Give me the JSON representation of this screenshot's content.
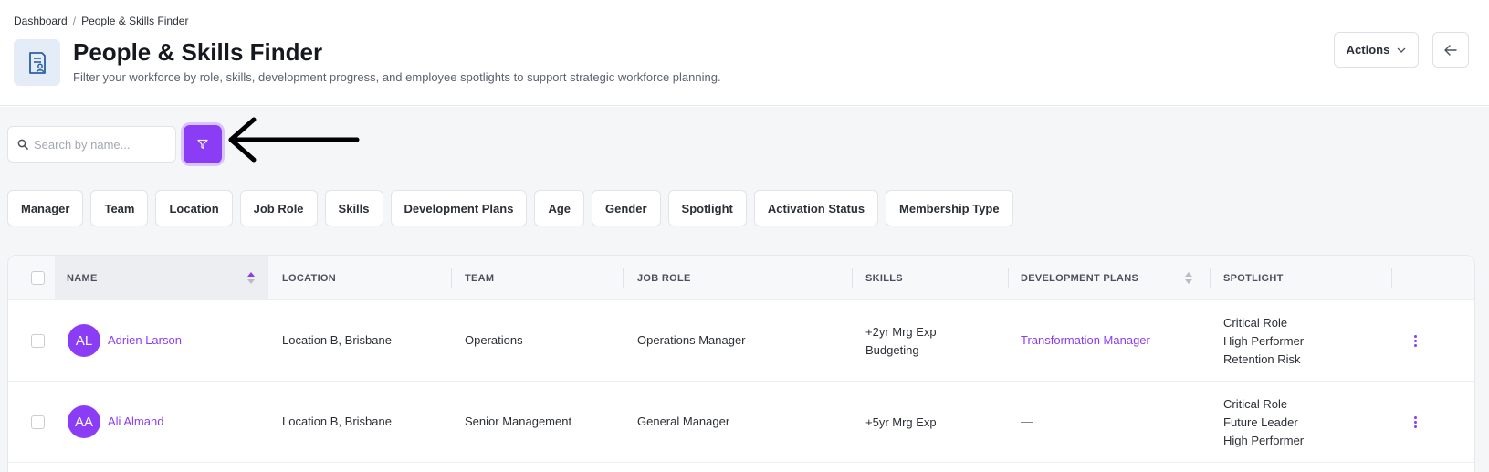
{
  "breadcrumb": {
    "root": "Dashboard",
    "separator": "/",
    "current": "People & Skills Finder"
  },
  "header": {
    "title": "People & Skills Finder",
    "subtitle": "Filter your workforce by role, skills, development progress, and employee spotlights to support strategic workforce planning.",
    "actions_label": "Actions",
    "icon": "document-person-icon",
    "back_icon": "arrow-left-icon"
  },
  "search": {
    "placeholder": "Search by name...",
    "value": ""
  },
  "filters": [
    "Manager",
    "Team",
    "Location",
    "Job Role",
    "Skills",
    "Development Plans",
    "Age",
    "Gender",
    "Spotlight",
    "Activation Status",
    "Membership Type"
  ],
  "table": {
    "columns": [
      "NAME",
      "LOCATION",
      "TEAM",
      "JOB ROLE",
      "SKILLS",
      "DEVELOPMENT PLANS",
      "SPOTLIGHT"
    ],
    "rows": [
      {
        "initials": "AL",
        "name": "Adrien Larson",
        "location": "Location B, Brisbane",
        "team": "Operations",
        "job_role": "Operations Manager",
        "skills": [
          "+2yr Mrg Exp",
          "Budgeting"
        ],
        "development_plan": "Transformation Manager",
        "spotlight": [
          "Critical Role",
          "High Performer",
          "Retention Risk"
        ]
      },
      {
        "initials": "AA",
        "name": "Ali Almand",
        "location": "Location B, Brisbane",
        "team": "Senior Management",
        "job_role": "General Manager",
        "skills": [
          "+5yr Mrg Exp"
        ],
        "development_plan": "—",
        "spotlight": [
          "Critical Role",
          "Future Leader",
          "High Performer"
        ]
      }
    ]
  },
  "colors": {
    "accent": "#8b3cf5",
    "icon_bg": "#e4ecf8",
    "page_bg": "#f5f6f8"
  }
}
